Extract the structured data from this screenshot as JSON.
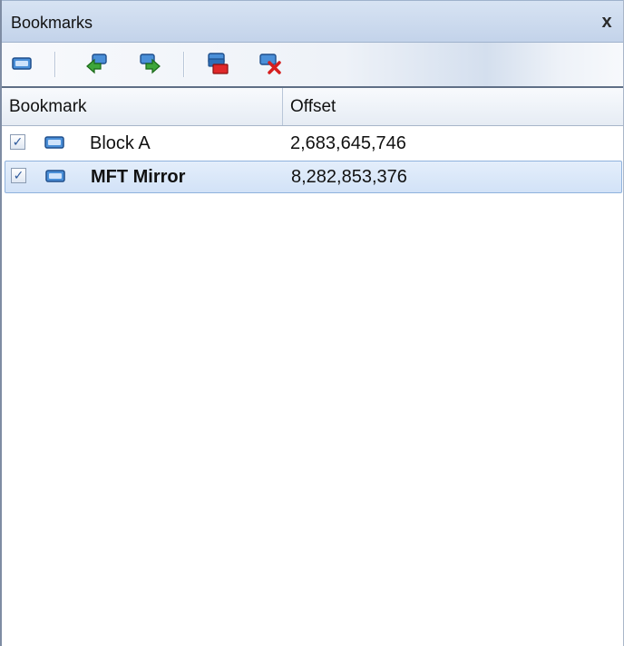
{
  "panel": {
    "title": "Bookmarks",
    "close_label": "x"
  },
  "toolbar": {
    "buttons": [
      {
        "name": "add-bookmark",
        "icon": "bookmark-icon"
      },
      {
        "name": "previous-bookmark",
        "icon": "arrow-left-icon"
      },
      {
        "name": "next-bookmark",
        "icon": "arrow-right-icon"
      },
      {
        "name": "delete-bookmark",
        "icon": "remove-bookmark-icon"
      },
      {
        "name": "clear-bookmarks",
        "icon": "delete-icon"
      }
    ]
  },
  "columns": {
    "bookmark": "Bookmark",
    "offset": "Offset"
  },
  "rows": [
    {
      "checked": true,
      "check_glyph": "✓",
      "name": "Block A",
      "offset": "2,683,645,746",
      "selected": false
    },
    {
      "checked": true,
      "check_glyph": "✓",
      "name": "MFT Mirror",
      "offset": "8,282,853,376",
      "selected": true
    }
  ],
  "colors": {
    "accent": "#4a8fd8",
    "selection": "#d2e2f7"
  }
}
